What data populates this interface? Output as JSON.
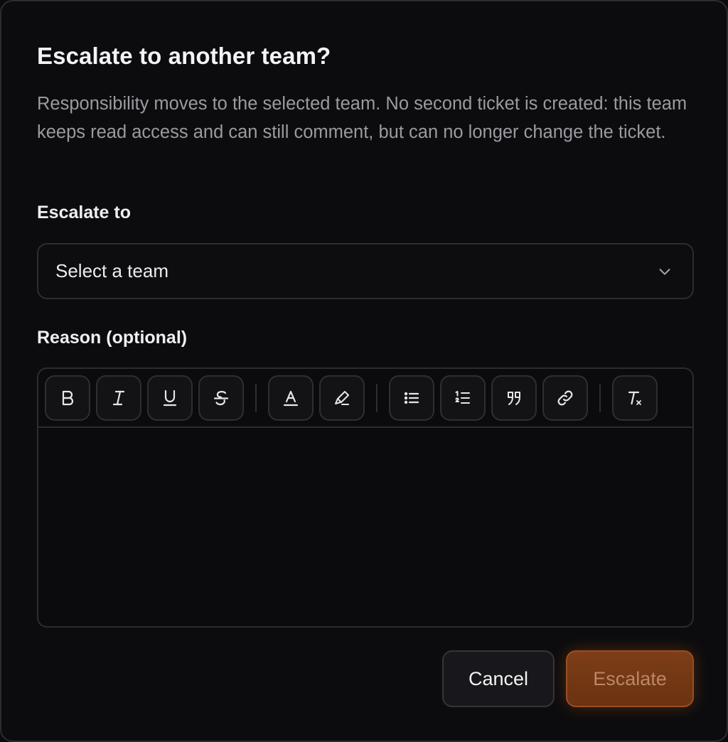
{
  "dialog": {
    "title": "Escalate to another team?",
    "description": "Responsibility moves to the selected team. No second ticket is created: this team keeps read access and can still comment, but can no longer change the ticket."
  },
  "team_field": {
    "label": "Escalate to",
    "selected_value": "Select a team",
    "icon": "chevron-down-icon"
  },
  "reason_field": {
    "label": "Reason (optional)",
    "value": "",
    "toolbar": [
      {
        "name": "bold",
        "icon": "bold-icon"
      },
      {
        "name": "italic",
        "icon": "italic-icon"
      },
      {
        "name": "underline",
        "icon": "underline-icon"
      },
      {
        "name": "strikethrough",
        "icon": "strikethrough-icon"
      },
      {
        "name": "text-color",
        "icon": "text-color-icon"
      },
      {
        "name": "highlight",
        "icon": "highlighter-icon"
      },
      {
        "name": "bullet-list",
        "icon": "bullet-list-icon"
      },
      {
        "name": "numbered-list",
        "icon": "numbered-list-icon"
      },
      {
        "name": "quote",
        "icon": "quote-icon"
      },
      {
        "name": "link",
        "icon": "link-icon"
      },
      {
        "name": "clear-formatting",
        "icon": "clear-formatting-icon"
      }
    ]
  },
  "actions": {
    "cancel_label": "Cancel",
    "escalate_label": "Escalate"
  },
  "colors": {
    "background": "#0c0c0e",
    "border": "#2c2c31",
    "accent": "#7d3d17",
    "muted_text": "#9a9aa1"
  }
}
